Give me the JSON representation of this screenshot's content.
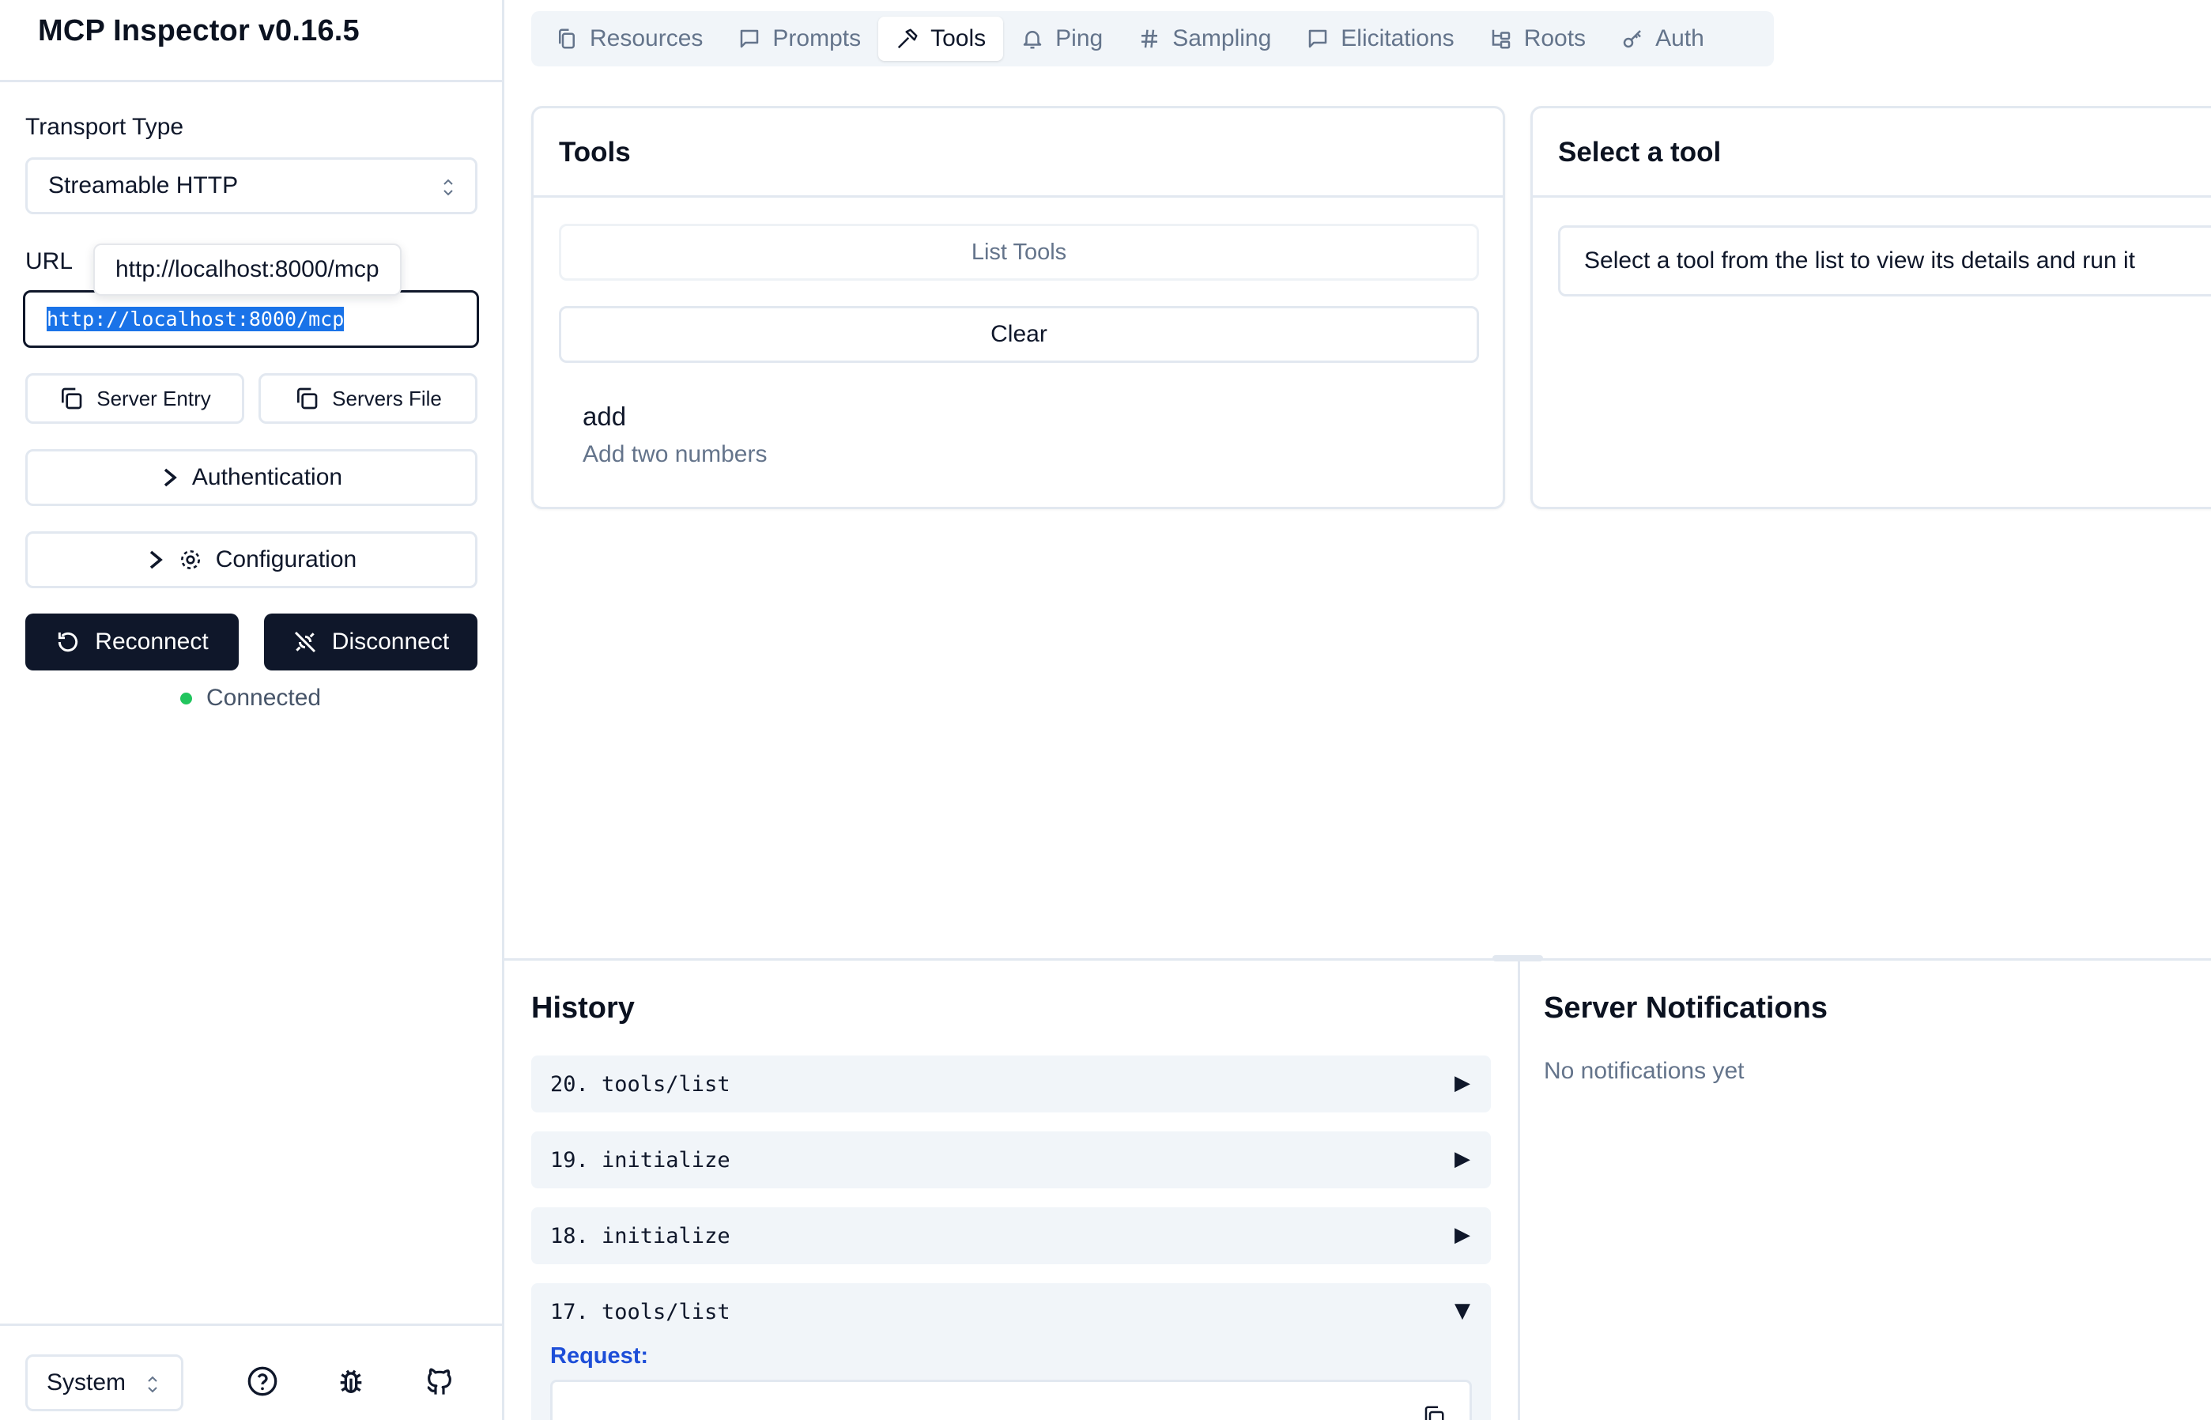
{
  "app": {
    "title": "MCP Inspector v0.16.5"
  },
  "sidebar": {
    "transport_label": "Transport Type",
    "transport_value": "Streamable HTTP",
    "url_label": "URL",
    "url_value": "http://localhost:8000/mcp",
    "url_tooltip": "http://localhost:8000/mcp",
    "server_entry_label": "Server Entry",
    "servers_file_label": "Servers File",
    "authentication_label": "Authentication",
    "configuration_label": "Configuration",
    "reconnect_label": "Reconnect",
    "disconnect_label": "Disconnect",
    "status_text": "Connected",
    "theme_value": "System"
  },
  "tabs": [
    {
      "label": "Resources",
      "icon": "files-icon",
      "active": false
    },
    {
      "label": "Prompts",
      "icon": "message-square-icon",
      "active": false
    },
    {
      "label": "Tools",
      "icon": "hammer-icon",
      "active": true
    },
    {
      "label": "Ping",
      "icon": "bell-icon",
      "active": false
    },
    {
      "label": "Sampling",
      "icon": "hash-icon",
      "active": false
    },
    {
      "label": "Elicitations",
      "icon": "message-square-icon",
      "active": false
    },
    {
      "label": "Roots",
      "icon": "folder-tree-icon",
      "active": false
    },
    {
      "label": "Auth",
      "icon": "key-icon",
      "active": false
    }
  ],
  "tools_panel": {
    "title": "Tools",
    "list_button": "List Tools",
    "clear_button": "Clear",
    "items": [
      {
        "name": "add",
        "description": "Add two numbers"
      }
    ]
  },
  "detail_panel": {
    "title": "Select a tool",
    "placeholder": "Select a tool from the list to view its details and run it"
  },
  "history": {
    "title": "History",
    "rows": [
      {
        "label": "20. tools/list",
        "arrow": "▶"
      },
      {
        "label": "19. initialize",
        "arrow": "▶"
      },
      {
        "label": "18. initialize",
        "arrow": "▶"
      },
      {
        "label": "17. tools/list",
        "arrow": "▼"
      }
    ],
    "request_label": "Request:"
  },
  "notifications": {
    "title": "Server Notifications",
    "empty_text": "No notifications yet"
  },
  "colors": {
    "primary_dark": "#0f172a",
    "muted_text": "#64748b",
    "border": "#e2e8f0",
    "tab_bg": "#f1f5f9",
    "status_green": "#22c55e",
    "request_blue": "#1d4ed8",
    "selection_blue": "#1a73e8"
  }
}
